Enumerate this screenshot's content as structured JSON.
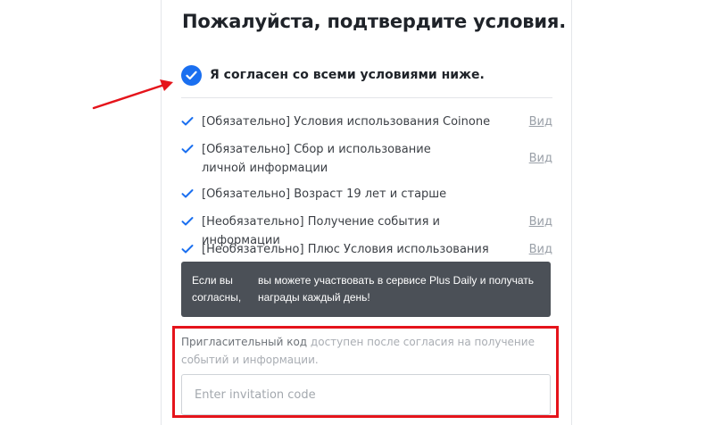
{
  "page": {
    "title": "Пожалуйста, подтвердите условия."
  },
  "agree_all": {
    "label": "Я согласен со всеми условиями ниже.",
    "checked": true,
    "icon": "check-circle-icon"
  },
  "terms": [
    {
      "text": "[Обязательно] Условия использования Coinone",
      "view": "Вид",
      "checked": true
    },
    {
      "text": "[Обязательно] Сбор и использование личной информации",
      "view": "Вид",
      "checked": true
    },
    {
      "text": "[Обязательно] Возраст 19 лет и старше",
      "view": "",
      "checked": true
    },
    {
      "text": "[Необязательно] Получение события и информации",
      "view": "Вид",
      "checked": true
    },
    {
      "text": "[Необязательно] Плюс Условия использования",
      "view": "Вид",
      "checked": true
    }
  ],
  "tooltip": {
    "left": "Если вы согласны,",
    "right": "вы можете участвовать в сервисе Plus Daily и получать награды каждый день!"
  },
  "invitation": {
    "label_strong": "Пригласительный код",
    "label_rest": " доступен после согласия на получение событий и информации.",
    "placeholder": "Enter invitation code",
    "value": ""
  },
  "colors": {
    "accent": "#1a6ff0",
    "highlight_box": "#e5141b",
    "annotation_arrow": "#e5141b",
    "tooltip_bg": "#4b5057"
  }
}
